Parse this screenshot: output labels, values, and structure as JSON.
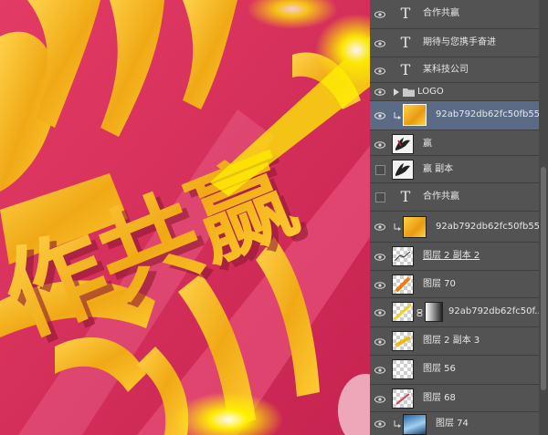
{
  "canvas": {
    "big_text": "作共赢",
    "accent_colors": {
      "background": "#d9305a",
      "gold": "#f2b21e",
      "glow": "#fff200"
    }
  },
  "layers": [
    {
      "label": "合作共赢",
      "kind": "text",
      "visible": true
    },
    {
      "label": "期待与您携手奋进",
      "kind": "text",
      "visible": true
    },
    {
      "label": "某科技公司",
      "kind": "text",
      "visible": true
    },
    {
      "label": "LOGO",
      "kind": "group",
      "visible": true
    },
    {
      "label": "92ab792db62fc50fb55...",
      "kind": "image-gold",
      "visible": true,
      "clipped": true,
      "selected": true
    },
    {
      "label": "赢",
      "kind": "image-brush",
      "visible": true
    },
    {
      "label": "赢 副本",
      "kind": "image-brush",
      "visible": false
    },
    {
      "label": "合作共赢",
      "kind": "text",
      "visible": false
    },
    {
      "label": "92ab792db62fc50fb55...",
      "kind": "image-gold",
      "visible": true,
      "clipped": true
    },
    {
      "label": "图层 2 副本 2",
      "kind": "image-transparent",
      "visible": true
    },
    {
      "label": "图层 70",
      "kind": "image-streak",
      "visible": true
    },
    {
      "label": "92ab792db62fc50f...",
      "kind": "image-masked",
      "visible": true
    },
    {
      "label": "图层 2 副本 3",
      "kind": "image-streak",
      "visible": true
    },
    {
      "label": "图层 56",
      "kind": "image-transparent",
      "visible": true
    },
    {
      "label": "图层 68",
      "kind": "image-streak-red",
      "visible": true
    },
    {
      "label": "图层 74",
      "kind": "image-blue",
      "visible": true,
      "clipped": true
    }
  ],
  "icons": {
    "eye": "eye-icon",
    "text": "text-layer-icon",
    "folder": "folder-icon",
    "expand": "chevron-right-icon",
    "clip": "clipping-arrow-icon",
    "link": "mask-link-icon"
  }
}
